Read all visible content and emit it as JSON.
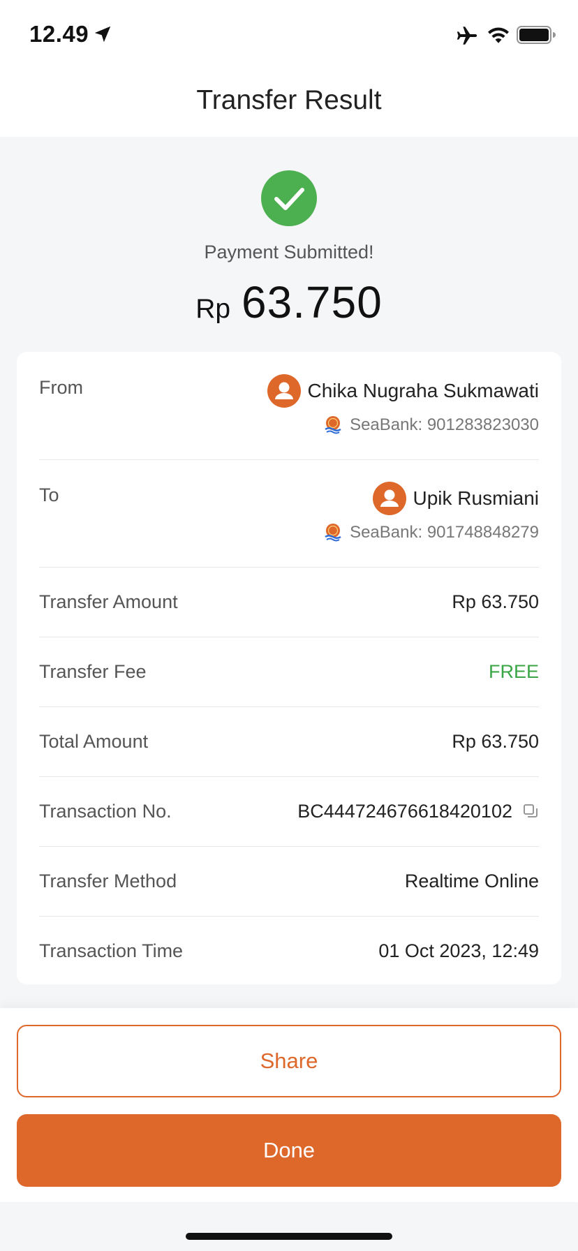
{
  "status_bar": {
    "time": "12.49",
    "icons": [
      "location-arrow-icon",
      "airplane-mode-icon",
      "wifi-icon",
      "battery-icon"
    ]
  },
  "nav": {
    "title": "Transfer Result"
  },
  "result": {
    "status": "Payment Submitted!",
    "currency": "Rp",
    "amount": "63.750",
    "icon": "check-circle-icon",
    "accent_color": "#4caf50"
  },
  "from": {
    "label": "From",
    "name": "Chika Nugraha Sukmawati",
    "bank": "SeaBank: 901283823030"
  },
  "to": {
    "label": "To",
    "name": "Upik Rusmiani",
    "bank": "SeaBank: 901748848279"
  },
  "details": {
    "transfer_amount": {
      "label": "Transfer Amount",
      "value": "Rp 63.750"
    },
    "transfer_fee": {
      "label": "Transfer Fee",
      "value": "FREE"
    },
    "total_amount": {
      "label": "Total Amount",
      "value": "Rp 63.750"
    },
    "transaction_no": {
      "label": "Transaction No.",
      "value": "BC444724676618420102"
    },
    "transfer_method": {
      "label": "Transfer Method",
      "value": "Realtime Online"
    },
    "transaction_time": {
      "label": "Transaction Time",
      "value": "01 Oct 2023, 12:49"
    }
  },
  "actions": {
    "share": "Share",
    "done": "Done"
  },
  "colors": {
    "brand": "#de672a",
    "success": "#3aa545",
    "background": "#f5f6f8"
  }
}
